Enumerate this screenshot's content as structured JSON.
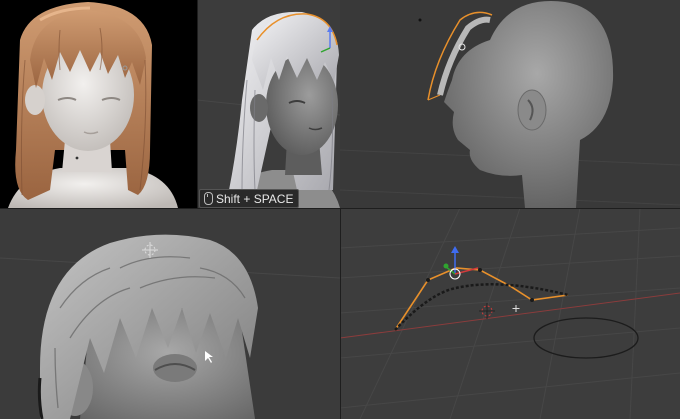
{
  "shortcut_hint": {
    "text": "Shift + SPACE",
    "icon": "mouse-icon"
  },
  "panels": [
    {
      "name": "render-preview",
      "icon": null
    },
    {
      "name": "hair-edit-viewport",
      "icon": "gizmo-axis-icon"
    },
    {
      "name": "side-profile-viewport",
      "icon": "curve-icon"
    },
    {
      "name": "hair-closeup-viewport",
      "icon": "3d-cursor-icon"
    },
    {
      "name": "curve-edit-viewport",
      "icon": "transform-gizmo-icon"
    }
  ],
  "colors": {
    "viewport_bg": "#3b3b3b",
    "grid_line": "#474747",
    "axis_red": "#8a3c3c",
    "selection_orange": "#e8902b",
    "hair_render": "#c08a62",
    "skin_render": "#e6e2df",
    "clay": "#9a9a9a"
  }
}
